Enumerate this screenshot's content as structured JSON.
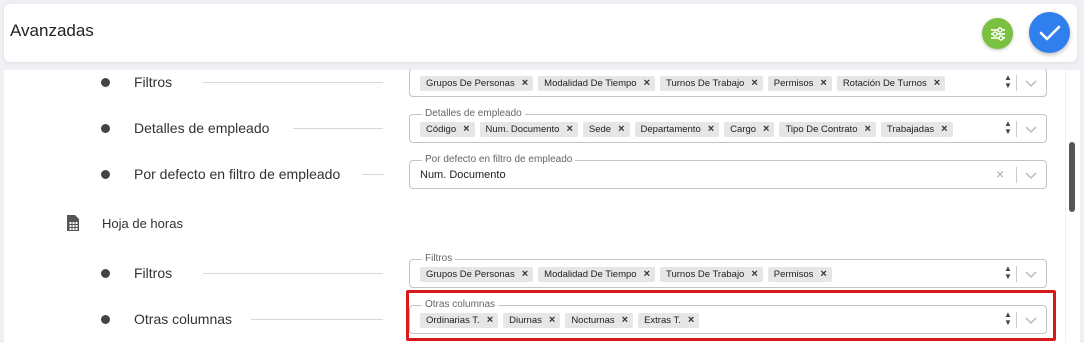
{
  "header": {
    "title": "Avanzadas"
  },
  "rows": {
    "r1": {
      "label": "Filtros",
      "chips": [
        "Grupos De Personas",
        "Modalidad De Tiempo",
        "Turnos De Trabajo",
        "Permisos",
        "Rotación De Turnos"
      ]
    },
    "r2": {
      "label": "Detalles de empleado",
      "legend": "Detalles de empleado",
      "chips": [
        "Código",
        "Num. Documento",
        "Sede",
        "Departamento",
        "Cargo",
        "Tipo De Contrato",
        "Trabajadas"
      ]
    },
    "r3": {
      "label": "Por defecto en filtro de empleado",
      "legend": "Por defecto en filtro de empleado",
      "value": "Num. Documento"
    },
    "section": {
      "label": "Hoja de horas"
    },
    "r4": {
      "label": "Filtros",
      "legend": "Filtros",
      "chips": [
        "Grupos De Personas",
        "Modalidad De Tiempo",
        "Turnos De Trabajo",
        "Permisos"
      ]
    },
    "r5": {
      "label": "Otras columnas",
      "legend": "Otras columnas",
      "chips": [
        "Ordinarias T.",
        "Diurnas",
        "Nocturnas",
        "Extras T."
      ]
    }
  },
  "icons": {
    "settings": "sliders-icon",
    "confirm": "check-icon",
    "section": "spreadsheet-icon",
    "remove": "close-icon",
    "sort": "up-down-icon",
    "dropdown": "chevron-down-icon"
  },
  "colors": {
    "settings_button": "#7ac142",
    "confirm_button": "#2f80ed",
    "highlight": "#d7191c"
  }
}
